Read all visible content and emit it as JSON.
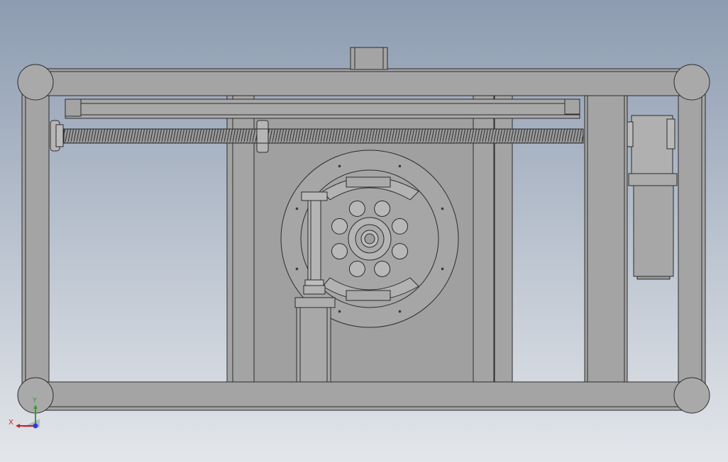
{
  "colors": {
    "background_top": "#8d9cb1",
    "background_bottom": "#e3e6ea",
    "part_fill": "#a4a4a4",
    "part_fill_light": "#b9b9b9",
    "edge": "#2b2b2b",
    "axis_x": "#d21e1e",
    "axis_y": "#2ea32e",
    "axis_z": "#2a3fd8"
  },
  "triad": {
    "x_label": "X",
    "y_label": "Y"
  },
  "gear": {
    "hole_count": 8,
    "bolt_count": 8
  },
  "leadscrew": {
    "thread_count": 170
  }
}
